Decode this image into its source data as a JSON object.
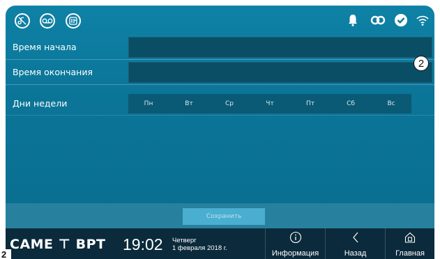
{
  "form": {
    "start_label": "Время начала",
    "start_value": "",
    "end_label": "Время окончания",
    "end_value": "",
    "days_label": "Дни недели",
    "days": [
      "Пн",
      "Вт",
      "Ср",
      "Чт",
      "Пт",
      "Сб",
      "Вс"
    ],
    "save_label": "Сохранить"
  },
  "statusbar": {
    "left_icons": [
      "mute-ring-icon",
      "voicemail-icon",
      "door-entry-icon"
    ],
    "right_icons": [
      "bell-icon",
      "link-icon",
      "check-icon",
      "wifi-icon"
    ]
  },
  "navbar": {
    "logo": "CAME ⊤ BPT",
    "time": "19:02",
    "weekday": "Четверг",
    "date": "1 февраля 2018 г.",
    "info_label": "Информация",
    "back_label": "Назад",
    "home_label": "Главная"
  },
  "annotations": {
    "callout": "2",
    "page_marker": "2"
  },
  "colors": {
    "screen_bg": "#0b7598",
    "field_bg": "#0a4e66",
    "day_bg": "#0a5a76",
    "navbar_bg": "#0b2a3b",
    "save_button_bg": "#4aaed0"
  }
}
